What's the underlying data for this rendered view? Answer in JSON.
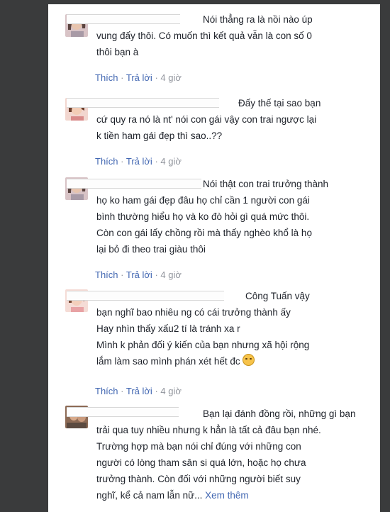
{
  "comments": [
    {
      "lines": [
        "Nói thẳng ra là nồi nào úp",
        "vung đấy thôi. Có muốn thì kết quả vẫn là con số 0",
        "thôi bạn à"
      ],
      "like": "Thích",
      "reply": "Trả lời",
      "time": "4 giờ"
    },
    {
      "lines": [
        "Đấy thế tại sao bạn",
        "cứ quy ra nó là nt' nói con gái vậy con trai ngược lại",
        "k tiền ham gái đẹp thì sao..??"
      ],
      "like": "Thích",
      "reply": "Trả lời",
      "time": "4 giờ"
    },
    {
      "lines": [
        "Nói thật con trai trưởng thành",
        "họ ko ham gái đẹp đâu họ chỉ cần 1 người con gái",
        "bình thường hiểu họ và ko đò hỏi gì quá mức thôi.",
        "Còn con gái lấy chồng rồi mà thấy nghèo khổ là họ",
        "lại bỏ đi theo trai giàu thôi"
      ],
      "like": "Thích",
      "reply": "Trả lời",
      "time": "4 giờ"
    },
    {
      "lines": [
        "Công Tuấn vậy",
        "bạn nghĩ bao nhiêu ng có cái trưởng thành ấy",
        "Hay nhìn thấy xấu2 tí là tránh xa r",
        "Mình k phản đối ý kiến của bạn nhưng xã hội rộng",
        "lắm làm sao mình phán xét hết đc"
      ],
      "like": "Thích",
      "reply": "Trả lời",
      "time": "4 giờ"
    },
    {
      "lines": [
        "Bạn lại đánh đồng rồi, những gì bạn",
        "trải qua tuy nhiều nhưng k hẳn là tất cả đâu bạn nhé.",
        "Trường hợp mà bạn nói chỉ đúng với những con",
        "người có lòng tham sân si quá lớn, hoặc họ chưa",
        "trưởng thành. Còn đối với những người biết suy",
        "nghĩ, kể cả nam lẫn nữ..."
      ],
      "more": "Xem thêm"
    }
  ],
  "separator": "·",
  "colors": {
    "link": "#4267b2",
    "meta": "#90949c",
    "text": "#1d2129",
    "background": "#3a3b3c"
  },
  "icons": {
    "sad_emoji": "sad-face-emoji-icon"
  }
}
